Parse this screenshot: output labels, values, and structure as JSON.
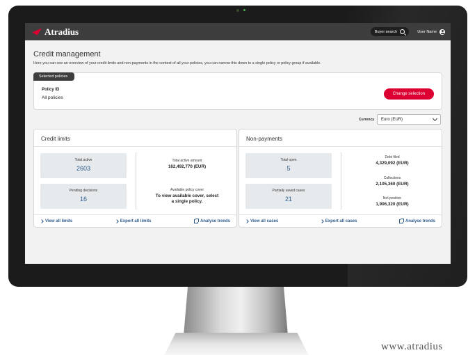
{
  "app": {
    "logo_text": "Atradius",
    "buyer_search_label": "Buyer search",
    "user_name": "User Name"
  },
  "page": {
    "title": "Credit management",
    "description": "Here you can see an overview of your credit limits and non-payments in the context of all your policies, you can narrow this down to a single policy or policy group if available."
  },
  "policy": {
    "tab_label": "Selected policies",
    "id_label": "Policy ID",
    "id_value": "All policies",
    "change_button": "Change selection"
  },
  "currency": {
    "label": "Currency",
    "selected": "Euro (EUR)"
  },
  "credit_limits": {
    "title": "Credit limits",
    "total_active_label": "Total active",
    "total_active_value": "2603",
    "pending_label": "Pending decisions",
    "pending_value": "16",
    "amount_label": "Total active amount",
    "amount_value": "162,492,770 (EUR)",
    "cover_label": "Available policy cover",
    "cover_text": "To view available cover, select a single policy.",
    "link_view": "View all limits",
    "link_export": "Export all limits",
    "link_trends": "Analyse trends"
  },
  "non_payments": {
    "title": "Non-payments",
    "total_open_label": "Total open",
    "total_open_value": "5",
    "partial_label": "Partially saved cases",
    "partial_value": "21",
    "debt_label": "Debt filed",
    "debt_value": "4,329,092 (EUR)",
    "collections_label": "Collections",
    "collections_value": "2,105,360 (EUR)",
    "net_label": "Net position",
    "net_value": "1,906,320 (EUR)",
    "link_view": "View all cases",
    "link_export": "Export all cases",
    "link_trends": "Analyse trends"
  },
  "watermark": "www.atradius",
  "colors": {
    "brand_red": "#dc0032",
    "topbar": "#3d3d3d",
    "value_blue": "#2d5a8c",
    "tile_bg": "#e6eaed"
  }
}
